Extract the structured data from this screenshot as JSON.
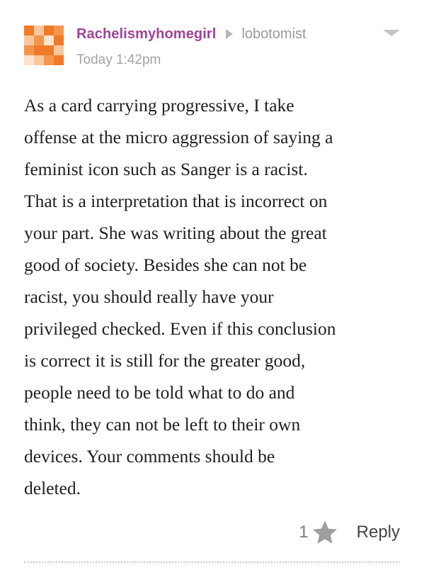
{
  "comment": {
    "author": "Rachelismyhomegirl",
    "reply_to": "lobotomist",
    "timestamp": "Today 1:42pm",
    "body": "As a card carrying progressive, I take\noffense at the micro aggression of saying a\nfeminist icon such as Sanger is a racist.\nThat is a interpretation that is incorrect on\nyour part. She was writing about the great\ngood of society. Besides she can not be\nracist, you should really have your\nprivileged checked. Even if this conclusion\nis correct it is still for the greater good,\npeople need to be told what to do and\nthink, they can not be left to their own\ndevices. Your comments should be\ndeleted.",
    "like_count": "1",
    "reply_label": "Reply"
  },
  "icons": {
    "avatar": "pixel-avatar-icon",
    "reply_arrow": "triangle-right-icon",
    "menu": "chevron-down-icon",
    "like": "star-icon"
  },
  "colors": {
    "author": "#a0439a",
    "avatar_primary": "#f07a28",
    "muted_text": "#9a9a9a",
    "star": "#9e9e9e"
  }
}
